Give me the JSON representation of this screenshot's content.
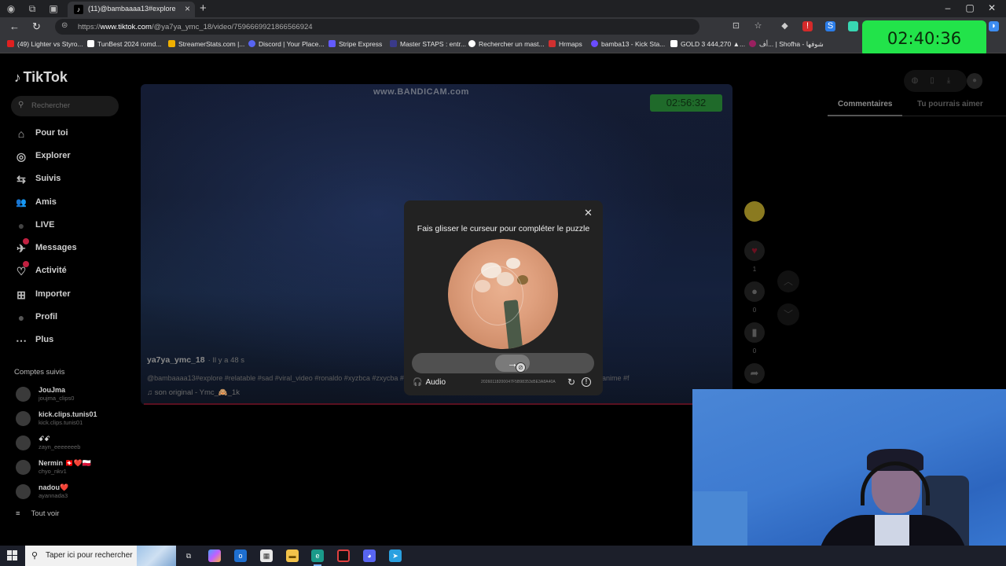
{
  "browser": {
    "active_tab_title": "(11)@bambaaaa13#explore #rel",
    "url_prefix": "https://",
    "url_host": "www.tiktok.com",
    "url_path": "/@ya7ya_ymc_18/video/7596669921866566924",
    "bookmarks": [
      {
        "label": "(49) Lighter vs Styro...",
        "color": "#e02020"
      },
      {
        "label": "TunBest 2024 romd...",
        "color": "#ffffff"
      },
      {
        "label": "StreamerStats.com |...",
        "color": "#f0b000"
      },
      {
        "label": "Discord | Your Place...",
        "color": "#5865f2"
      },
      {
        "label": "Stripe Express",
        "color": "#635bff"
      },
      {
        "label": "Master STAPS : entr...",
        "color": "#3a3a8a"
      },
      {
        "label": "Rechercher un mast...",
        "color": "#ffffff"
      },
      {
        "label": "Hrmaps",
        "color": "#d03030"
      },
      {
        "label": "bamba13 - Kick Sta...",
        "color": "#6a4cff"
      },
      {
        "label": "GOLD 3 444,270 ▲...",
        "color": "#ffffff"
      },
      {
        "label": "أف... | Shofha - شوفها",
        "color": "#9a2060"
      }
    ]
  },
  "stream_timer": "02:40:36",
  "tiktok": {
    "logo": "TikTok",
    "search_placeholder": "Rechercher",
    "nav": [
      {
        "label": "Pour toi",
        "icon": "home-icon",
        "glyph": "⌂"
      },
      {
        "label": "Explorer",
        "icon": "compass-icon",
        "glyph": "◎"
      },
      {
        "label": "Suivis",
        "icon": "following-icon",
        "glyph": "⇆"
      },
      {
        "label": "Amis",
        "icon": "friends-icon",
        "glyph": "👥"
      },
      {
        "label": "LIVE",
        "icon": "live-icon",
        "glyph": "●"
      },
      {
        "label": "Messages",
        "icon": "messages-icon",
        "glyph": "✈"
      },
      {
        "label": "Activité",
        "icon": "activity-icon",
        "glyph": "♡"
      },
      {
        "label": "Importer",
        "icon": "upload-icon",
        "glyph": "⊞"
      },
      {
        "label": "Profil",
        "icon": "profile-icon",
        "glyph": "●"
      },
      {
        "label": "Plus",
        "icon": "more-icon",
        "glyph": "⋯"
      }
    ],
    "following_title": "Comptes suivis",
    "following": [
      {
        "name": "JouJma",
        "handle": "joujma_clips0"
      },
      {
        "name": "kick.clips.tunis01",
        "handle": "kick.clips.tunis01"
      },
      {
        "name": "ꗃꗃ",
        "handle": "zayn_eeeeeeeb"
      },
      {
        "name": "Nermin 🇨🇭❤️🇵🇱",
        "handle": "chyo_nkv1"
      },
      {
        "name": "nadou❤️",
        "handle": "ayannada3"
      }
    ],
    "see_all": "Tout voir",
    "right_tabs": [
      "Commentaires",
      "Tu pourrais aimer"
    ],
    "video": {
      "watermark": "www.BANDICAM.com",
      "timer": "02:56:32",
      "author": "ya7ya_ymc_18",
      "posted": "· Il y a 48 s",
      "caption": "@bambaaaa13#explore #relatable #sad #viral_video #ronaldo #xyzbca #zxycba #duet #valorant #gta5 #bb #azerbaycan #e #zodiacsigns #viral #anime #f",
      "music": "♫  son original - Ymc_🙈_1k",
      "likes": "1",
      "comments": "0",
      "saves": "0"
    },
    "captcha": {
      "title": "Fais glisser le curseur pour compléter le puzzle",
      "audio_label": "Audio",
      "code": "20260118200047F5B98353d5E3A8A40A"
    }
  },
  "taskbar": {
    "search_placeholder": "Taper ici pour rechercher"
  }
}
